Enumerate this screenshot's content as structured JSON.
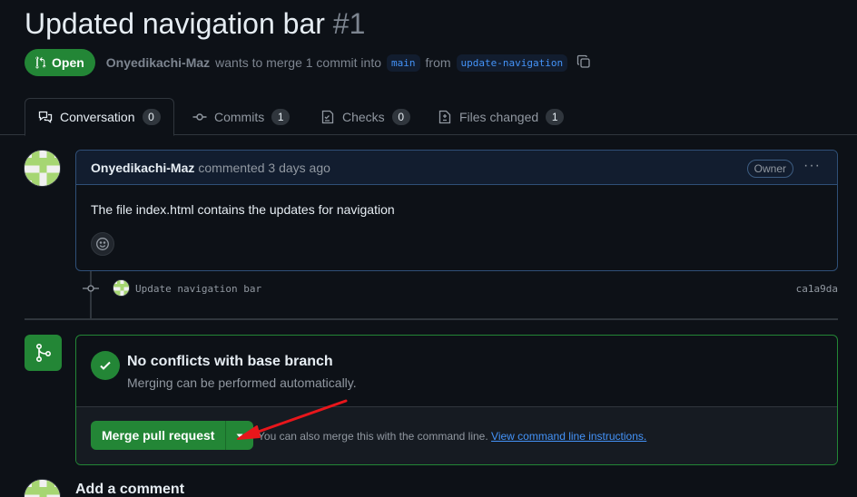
{
  "header": {
    "title": "Updated navigation bar",
    "number": "#1",
    "state": "Open",
    "author": "Onyedikachi-Maz",
    "merge_text": "wants to merge 1 commit into",
    "base_branch": "main",
    "from_text": "from",
    "head_branch": "update-navigation"
  },
  "tabs": [
    {
      "label": "Conversation",
      "count": "0",
      "icon": "comment-discussion-icon"
    },
    {
      "label": "Commits",
      "count": "1",
      "icon": "git-commit-icon"
    },
    {
      "label": "Checks",
      "count": "0",
      "icon": "checklist-icon"
    },
    {
      "label": "Files changed",
      "count": "1",
      "icon": "file-diff-icon"
    }
  ],
  "comment": {
    "author": "Onyedikachi-Maz",
    "action": "commented 3 days ago",
    "badge": "Owner",
    "menu": "···",
    "body": "The file index.html contains the updates for navigation"
  },
  "commit": {
    "message": "Update navigation bar",
    "sha": "ca1a9da"
  },
  "merge": {
    "title": "No conflicts with base branch",
    "subtitle": "Merging can be performed automatically.",
    "button_label": "Merge pull request",
    "cmd_text": "You can also merge this with the command line.",
    "cmd_link": "View command line instructions."
  },
  "add_comment": {
    "title": "Add a comment"
  },
  "colors": {
    "background": "#0d1117",
    "accent_green": "#238636",
    "link_blue": "#4493f8",
    "annotation_red": "#e8161b"
  }
}
